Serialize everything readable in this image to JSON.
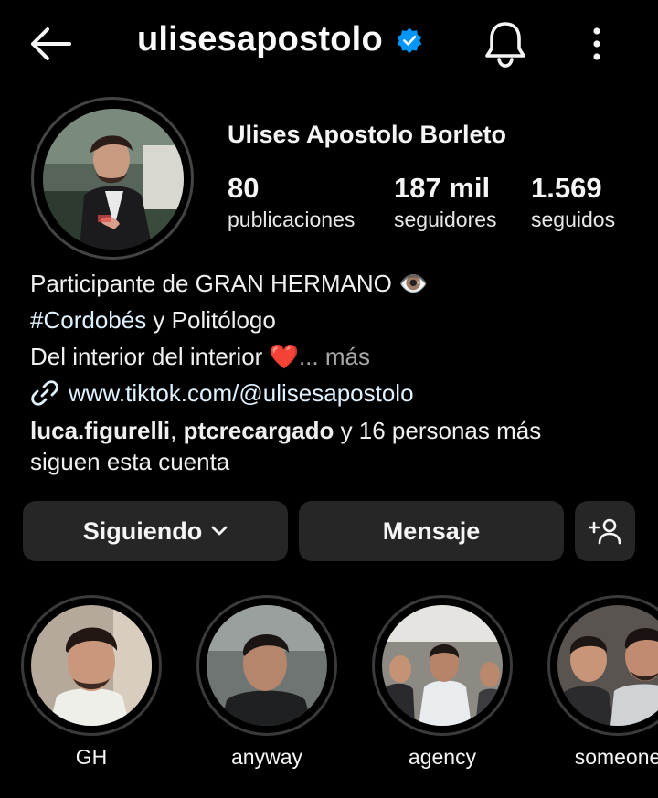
{
  "header": {
    "username": "ulisesapostolo",
    "verified": true,
    "icons": [
      "arrow-left-icon",
      "verified-badge-icon",
      "bell-icon",
      "more-vertical-icon"
    ]
  },
  "profile": {
    "full_name": "Ulises Apostolo Borleto",
    "stats": [
      {
        "value": "80",
        "label": "publicaciones"
      },
      {
        "value": "187 mil",
        "label": "seguidores"
      },
      {
        "value": "1.569",
        "label": "seguidos"
      }
    ]
  },
  "bio": {
    "line1": "Participante de GRAN HERMANO",
    "line1_emoji": "👁️",
    "hashtag": "#Cordobés",
    "line2_rest": " y Politólogo",
    "line3": "Del interior del interior",
    "line3_emoji": "❤️",
    "more": "... más",
    "link": "www.tiktok.com/@ulisesapostolo"
  },
  "followed_by": {
    "user1": "luca.figurelli",
    "separator": ", ",
    "user2": "ptcrecargado",
    "rest_line1": " y 16 personas más",
    "line2": "siguen esta cuenta"
  },
  "actions": {
    "following_label": "Siguiendo",
    "message_label": "Mensaje",
    "add_user_icon": "add-user-icon"
  },
  "highlights": [
    {
      "label": "GH"
    },
    {
      "label": "anyway"
    },
    {
      "label": "agency"
    },
    {
      "label": "someone"
    }
  ],
  "colors": {
    "background": "#000000",
    "button": "#262626",
    "verified": "#0095f6",
    "link": "#e0f1ff",
    "muted": "#a8a8a8"
  }
}
